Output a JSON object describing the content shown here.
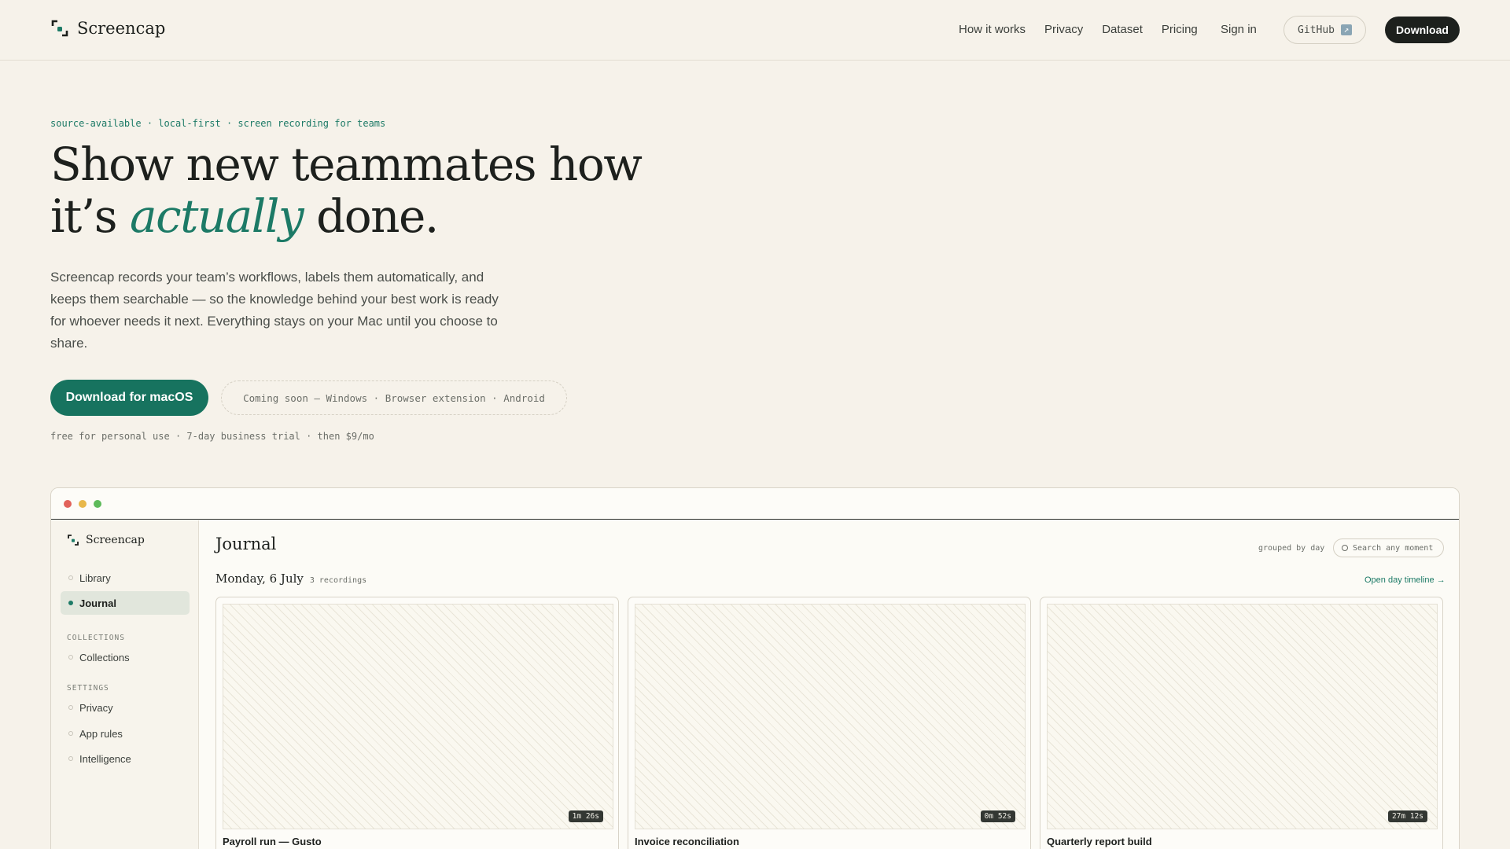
{
  "brand": {
    "name": "Screencap"
  },
  "nav": {
    "links": [
      "How it works",
      "Privacy",
      "Dataset",
      "Pricing"
    ],
    "sign_in": "Sign in",
    "github": "GitHub",
    "download": "Download"
  },
  "hero": {
    "eyebrow": "source-available · local-first · screen recording for teams",
    "headline_line1": "Show new teammates how",
    "headline_prefix": "it’s ",
    "headline_emphasis": "actually",
    "headline_suffix": " done.",
    "lede": "Screencap records your team’s workflows, labels them automatically, and keeps them searchable — so the knowledge behind your best work is ready for whoever needs it next. Everything stays on your Mac until you choose to share.",
    "cta": "Download for macOS",
    "coming_soon": "Coming soon — Windows · Browser extension · Android",
    "fineprint": "free for personal use · 7-day business trial · then $9/mo"
  },
  "app": {
    "sidebar": {
      "brand": "Screencap",
      "items": [
        {
          "label": "Library",
          "active": false
        },
        {
          "label": "Journal",
          "active": true
        }
      ],
      "collections_header": "COLLECTIONS",
      "collections_items": [
        "Collections"
      ],
      "settings_header": "SETTINGS",
      "settings_items": [
        "Privacy",
        "App rules",
        "Intelligence"
      ]
    },
    "main": {
      "title": "Journal",
      "grouped_label": "grouped by day",
      "search_placeholder": "Search any moment",
      "day_label": "Monday, 6 July",
      "day_count": "3 recordings",
      "timeline_link": "Open day timeline →",
      "cards": [
        {
          "title": "Payroll run — Gusto",
          "duration": "1m 26s"
        },
        {
          "title": "Invoice reconciliation",
          "duration": "0m 52s"
        },
        {
          "title": "Quarterly report build",
          "duration": "27m 12s"
        }
      ]
    }
  },
  "colors": {
    "accent": "#1c7a66",
    "background": "#f6f2ea",
    "ink": "#1d201d"
  }
}
